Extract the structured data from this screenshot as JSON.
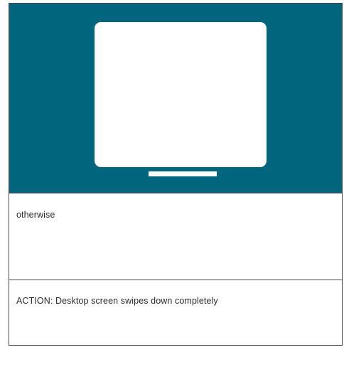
{
  "colors": {
    "panel_background": "#02657e",
    "screen": "#ffffff",
    "border": "#4a4a4a",
    "text": "#2b2b2b"
  },
  "illustration": {
    "icon": "desktop-monitor-icon"
  },
  "panels": [
    {
      "text": "otherwise"
    },
    {
      "text": "ACTION: Desktop screen swipes down completely"
    }
  ]
}
